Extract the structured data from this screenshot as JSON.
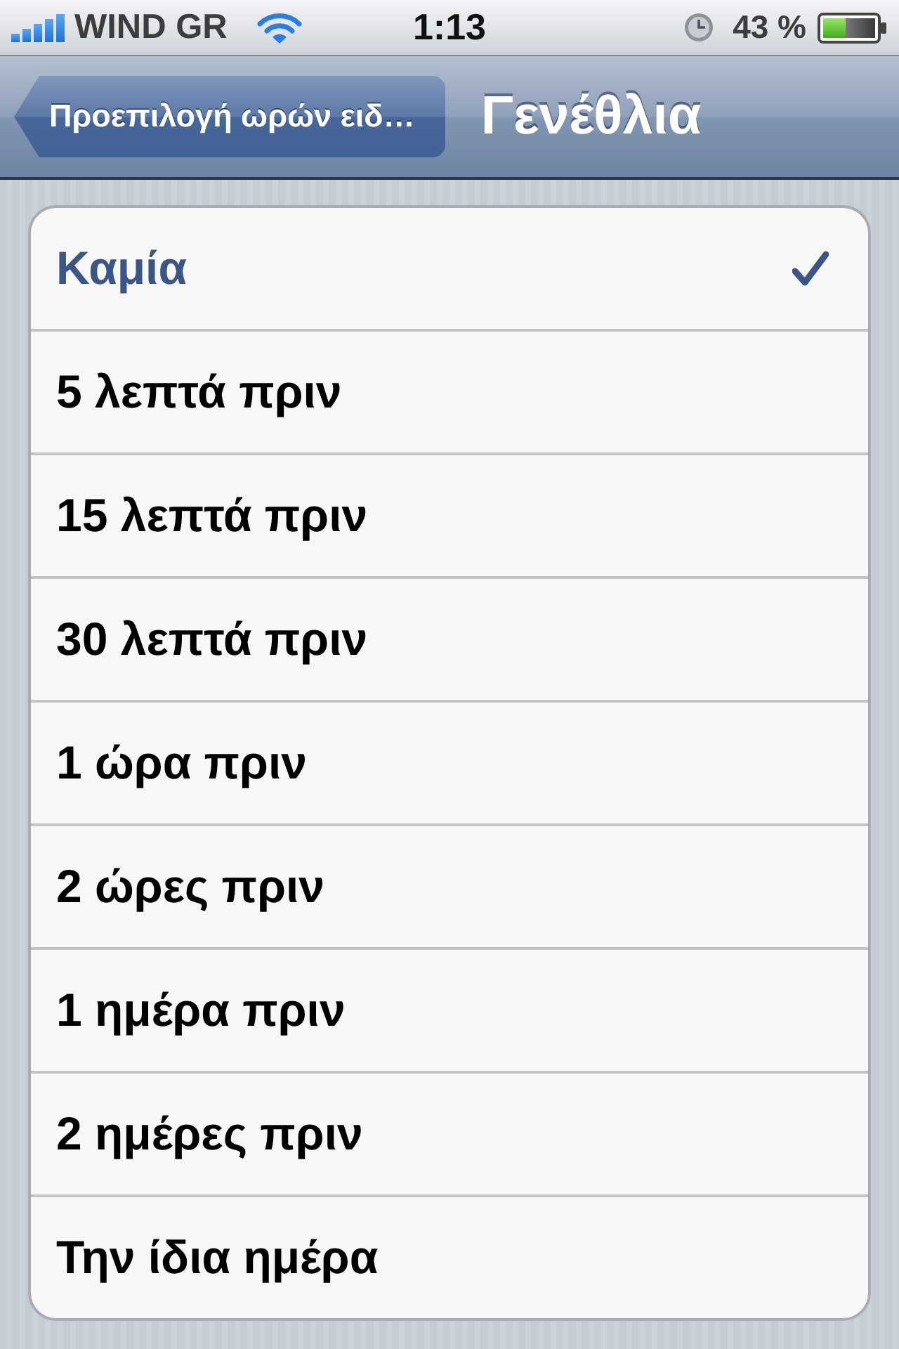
{
  "status_bar": {
    "carrier": "WIND GR",
    "time": "1:13",
    "battery": "43 %"
  },
  "nav_bar": {
    "back_button": "Προεπιλογή ωρών ειδ…",
    "title": "Γενέθλια"
  },
  "options": [
    {
      "label": "Καμία",
      "selected": true
    },
    {
      "label": "5 λεπτά πριν",
      "selected": false
    },
    {
      "label": "15 λεπτά πριν",
      "selected": false
    },
    {
      "label": "30 λεπτά πριν",
      "selected": false
    },
    {
      "label": "1 ώρα πριν",
      "selected": false
    },
    {
      "label": "2 ώρες πριν",
      "selected": false
    },
    {
      "label": "1 ημέρα πριν",
      "selected": false
    },
    {
      "label": "2 ημέρες πριν",
      "selected": false
    },
    {
      "label": "Την ίδια ημέρα",
      "selected": false
    }
  ]
}
